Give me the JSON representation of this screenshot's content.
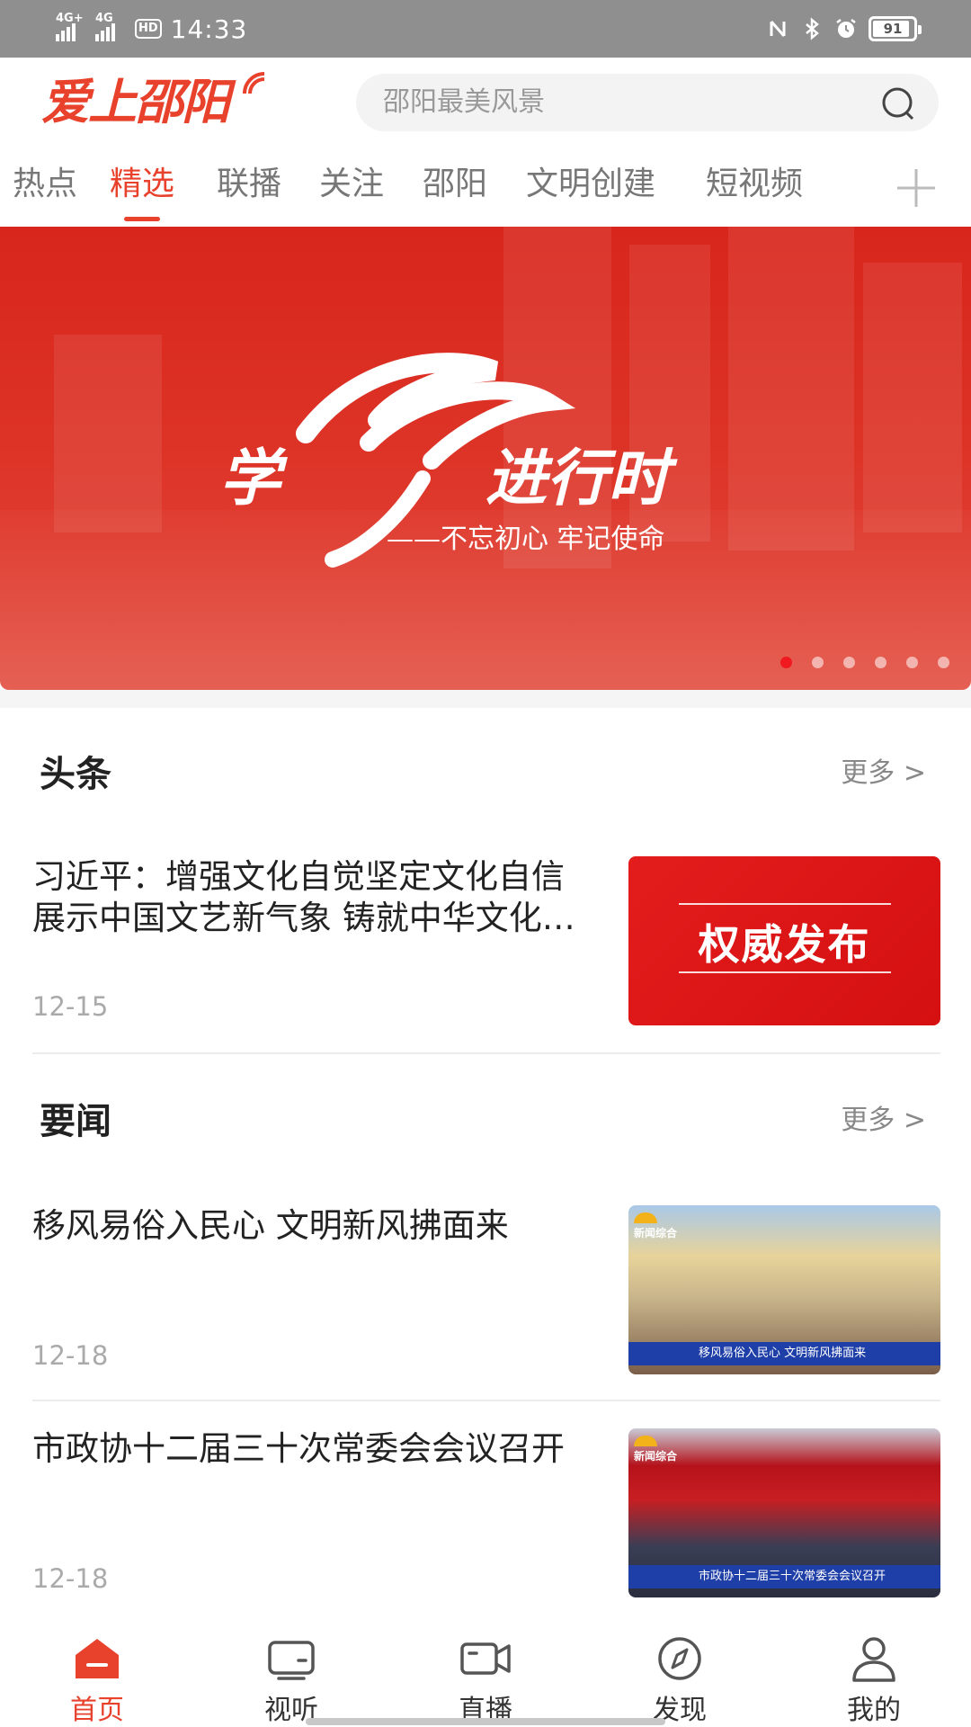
{
  "status_bar": {
    "signal1": "4G+",
    "signal2": "4G",
    "hd": "HD",
    "time": "14:33",
    "battery": "91",
    "battery_level": 0.91
  },
  "header": {
    "logo_text": "爱上邵阳",
    "search_placeholder": "邵阳最美风景",
    "accent_color": "#e8412c"
  },
  "tabs": [
    {
      "label": "热点",
      "active": false
    },
    {
      "label": "精选",
      "active": true
    },
    {
      "label": "联播",
      "active": false
    },
    {
      "label": "关注",
      "active": false
    },
    {
      "label": "邵阳",
      "active": false
    },
    {
      "label": "文明创建",
      "active": false
    },
    {
      "label": "短视频",
      "active": false
    }
  ],
  "banner": {
    "text_left": "学",
    "text_art": "习",
    "text_right": "进行时",
    "subtitle": "——不忘初心 牢记使命",
    "slide_count": 6,
    "active_slide": 1
  },
  "headlines": {
    "title": "头条",
    "more": "更多 >",
    "items": [
      {
        "title": "习近平：增强文化自觉坚定文化自信 展示中国文艺新气象 铸就中华文化新辉煌",
        "date": "12-15",
        "thumb_text": "权威发布"
      }
    ]
  },
  "news": {
    "title": "要闻",
    "more": "更多 >",
    "items": [
      {
        "title": "移风易俗入民心 文明新风拂面来",
        "date": "12-18",
        "ticker": "移风易俗入民心 文明新风拂面来",
        "channel": "新闻综合"
      },
      {
        "title": "市政协十二届三十次常委会会议召开",
        "date": "12-18",
        "ticker": "市政协十二届三十次常委会会议召开",
        "channel": "新闻综合"
      }
    ]
  },
  "bottom_nav": [
    {
      "label": "首页",
      "icon": "home-icon",
      "active": true
    },
    {
      "label": "视听",
      "icon": "tv-icon",
      "active": false
    },
    {
      "label": "直播",
      "icon": "video-camera-icon",
      "active": false
    },
    {
      "label": "发现",
      "icon": "compass-icon",
      "active": false
    },
    {
      "label": "我的",
      "icon": "user-icon",
      "active": false
    }
  ]
}
